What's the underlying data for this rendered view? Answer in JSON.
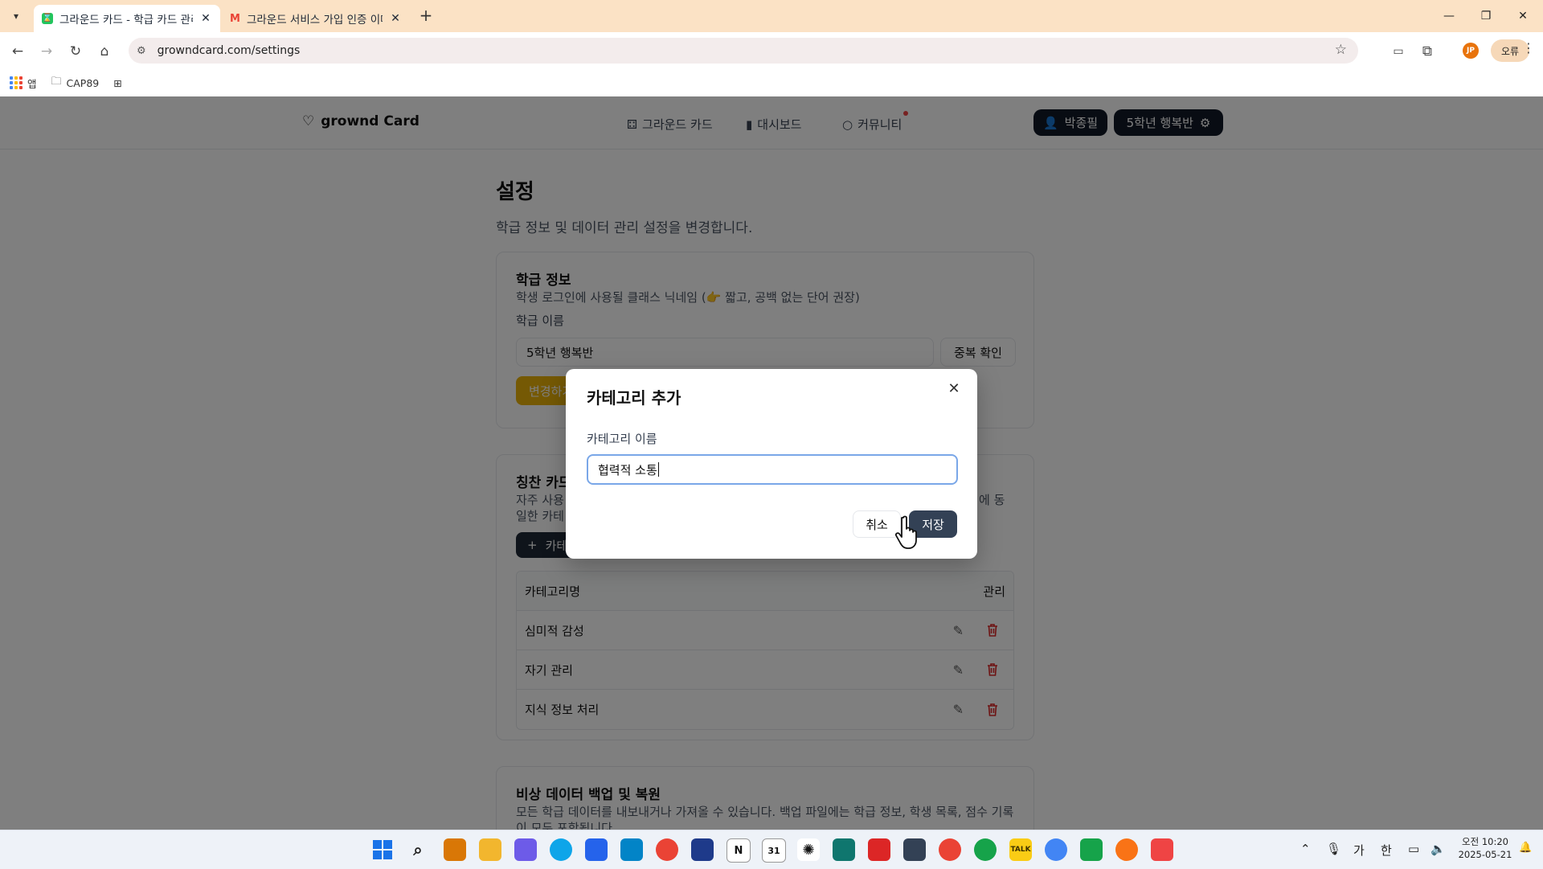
{
  "browser": {
    "tabs": [
      {
        "title": "그라운드 카드 - 학급 카드 관리",
        "active": true
      },
      {
        "title": "그라운드 서비스 가입 인증 이메일",
        "active": false
      }
    ],
    "url": "growndcard.com/settings",
    "profile_initials": "JP",
    "error_label": "오류",
    "bookmarks": {
      "apps": "앱",
      "folder": "CAP89"
    }
  },
  "nav": {
    "brand": "grownd Card",
    "links": [
      {
        "label": "그라운드 카드",
        "icon": "cards-icon"
      },
      {
        "label": "대시보드",
        "icon": "bar-chart-icon"
      },
      {
        "label": "커뮤니티",
        "icon": "chat-icon",
        "badge": true
      }
    ],
    "user": "박종필",
    "class": "5학년 행복반"
  },
  "settings": {
    "title": "설정",
    "subtitle": "학급 정보 및 데이터 관리 설정을 변경합니다.",
    "class_info": {
      "title": "학급 정보",
      "desc": "학생 로그인에 사용될 클래스 닉네임 (👉 짧고, 공백 없는 단어 권장)",
      "label": "학급 이름",
      "value": "5학년 행복반",
      "check_button": "중복 확인",
      "save_button": "변경하기"
    },
    "praise_card": {
      "title": "칭찬 카드",
      "desc_left_1": "자주 사용",
      "desc_right_1": "에 동",
      "desc_left_2": "일한 카테",
      "add_button": "카테고리 추가",
      "columns": {
        "name": "카테고리명",
        "manage": "관리"
      },
      "rows": [
        {
          "name": "심미적 감성"
        },
        {
          "name": "자기 관리"
        },
        {
          "name": "지식 정보 처리"
        }
      ]
    },
    "backup": {
      "title": "비상 데이터 백업 및 복원",
      "desc": "모든 학급 데이터를 내보내거나 가져올 수 있습니다. 백업 파일에는 학급 정보, 학생 목록, 점수 기록이 모두 포함됩니다."
    }
  },
  "modal": {
    "title": "카테고리 추가",
    "label": "카테고리 이름",
    "value": "협력적 소통",
    "cancel": "취소",
    "save": "저장"
  },
  "taskbar": {
    "ime_mode": "가",
    "ime_lang": "한",
    "time": "오전 10:20",
    "date": "2025-05-21"
  },
  "colors": {
    "accent_yellow": "#eab308",
    "dark": "#111827",
    "delete_red": "#dc2626",
    "focus_ring": "#7aa7e8"
  }
}
